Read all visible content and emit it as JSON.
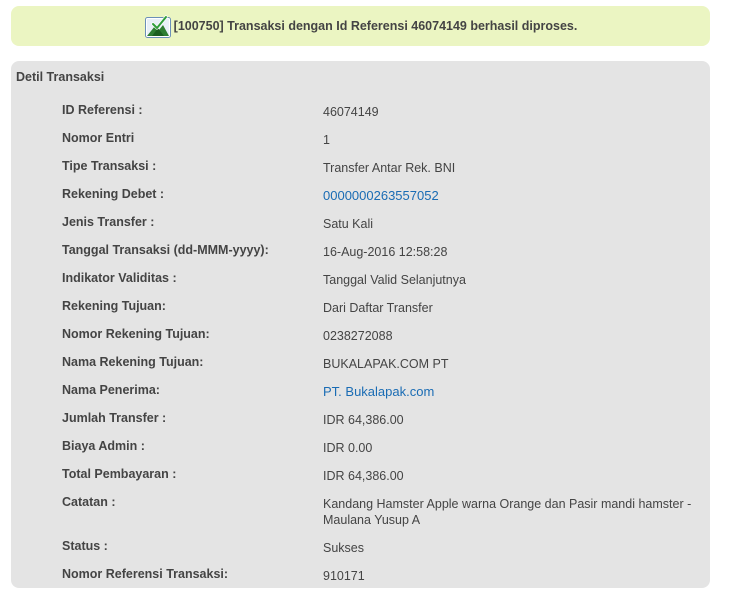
{
  "banner": {
    "message": "[100750] Transaksi dengan Id Referensi 46074149 berhasil diproses.",
    "icon": "success-check-icon",
    "background": "#ebf5c2"
  },
  "panel": {
    "title": "Detil Transaksi",
    "background": "#e4e4e4"
  },
  "colors": {
    "text": "#444444",
    "link": "#1a6cb4"
  },
  "details": [
    {
      "label": "ID Referensi :",
      "value": "46074149",
      "link": false
    },
    {
      "label": "Nomor Entri",
      "value": "1",
      "link": false
    },
    {
      "label": "Tipe Transaksi :",
      "value": "Transfer Antar Rek. BNI",
      "link": false
    },
    {
      "label": "Rekening Debet :",
      "value": "0000000263557052",
      "link": true
    },
    {
      "label": "Jenis Transfer :",
      "value": "Satu Kali",
      "link": false
    },
    {
      "label": "Tanggal Transaksi (dd-MMM-yyyy):",
      "value": "16-Aug-2016 12:58:28",
      "link": false
    },
    {
      "label": "Indikator Validitas :",
      "value": "Tanggal Valid Selanjutnya",
      "link": false
    },
    {
      "label": "Rekening Tujuan:",
      "value": "Dari Daftar Transfer",
      "link": false
    },
    {
      "label": "Nomor Rekening Tujuan:",
      "value": "0238272088",
      "link": false
    },
    {
      "label": "Nama Rekening Tujuan:",
      "value": "BUKALAPAK.COM PT",
      "link": false
    },
    {
      "label": "Nama Penerima:",
      "value": "PT. Bukalapak.com",
      "link": true
    },
    {
      "label": "Jumlah Transfer :",
      "value": "IDR 64,386.00",
      "link": false
    },
    {
      "label": "Biaya Admin :",
      "value": "IDR 0.00",
      "link": false
    },
    {
      "label": "Total Pembayaran :",
      "value": "IDR 64,386.00",
      "link": false
    },
    {
      "label": "Catatan :",
      "value": "Kandang Hamster Apple warna Orange dan Pasir mandi hamster - Maulana Yusup A",
      "link": false
    },
    {
      "label": "Status :",
      "value": "Sukses",
      "link": false
    },
    {
      "label": "Nomor Referensi Transaksi:",
      "value": "910171",
      "link": false
    }
  ]
}
